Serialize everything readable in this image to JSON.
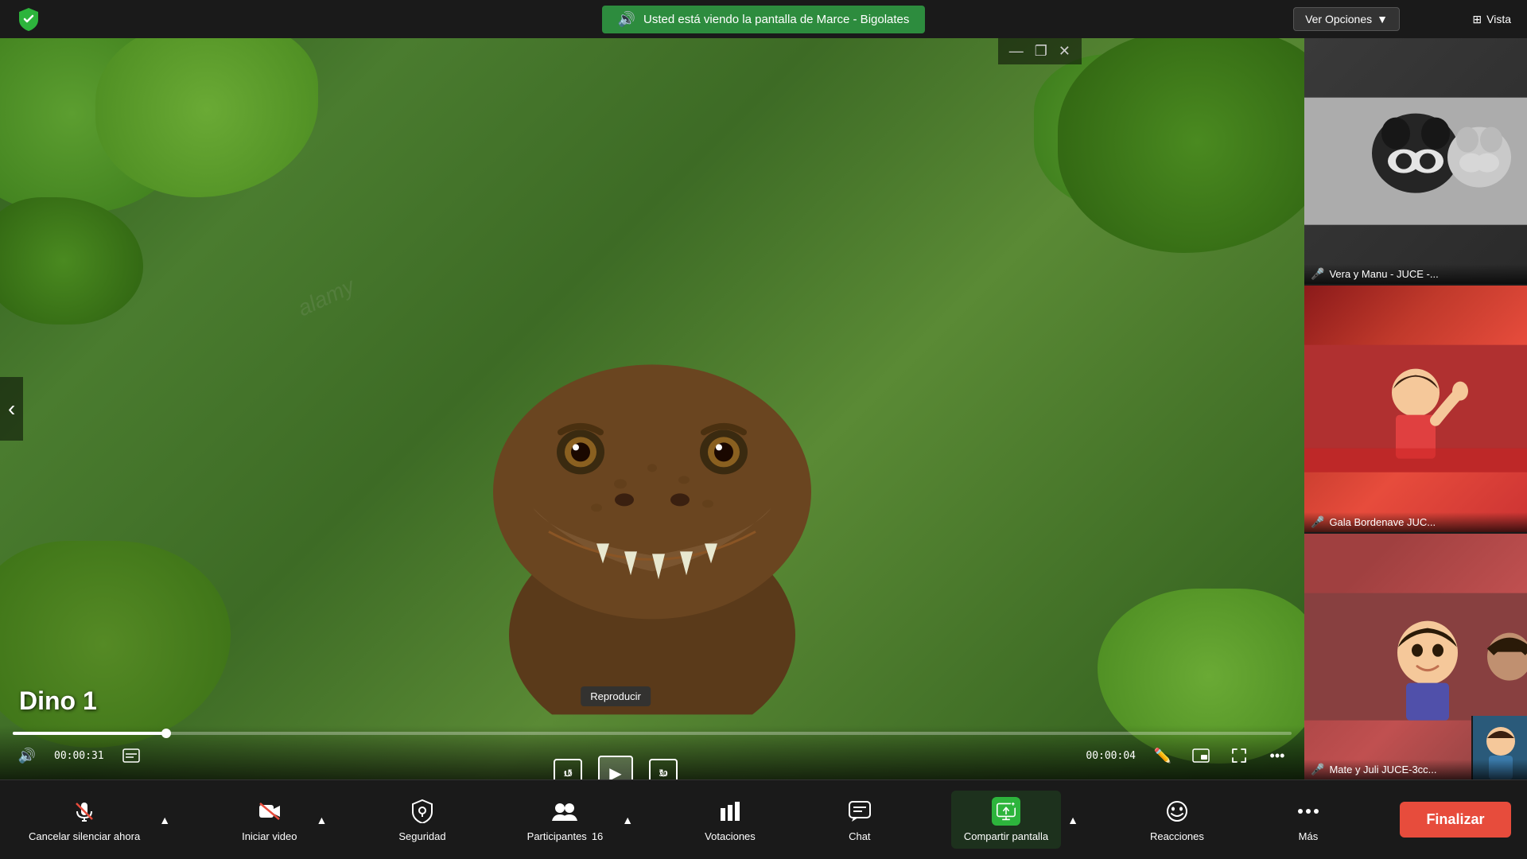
{
  "topBar": {
    "shieldColor": "#2db43c",
    "bannerText": "Usted está viendo la pantalla de Marce - Bigolates",
    "verOpciones": "Ver Opciones",
    "vista": "Vista"
  },
  "mainVideo": {
    "title": "Dino 1",
    "timeElapsed": "00:00:31",
    "timeRemaining": "00:00:04",
    "tooltip": "Reproducir",
    "watermark": "alamy",
    "watermark2": "alamy"
  },
  "participants": [
    {
      "name": "Vera y Manu - JUCE -...",
      "micOff": true
    },
    {
      "name": "Gala Bordenave JUC...",
      "micOff": true
    },
    {
      "name": "Mate y Juli JUCE-3cc...",
      "micOff": true
    }
  ],
  "toolbar": {
    "cancelarSilenciar": "Cancelar silenciar ahora",
    "iniciarVideo": "Iniciar video",
    "seguridad": "Seguridad",
    "participantes": "Participantes",
    "participantesCount": "16",
    "votaciones": "Votaciones",
    "chat": "Chat",
    "compartirPantalla": "Compartir pantalla",
    "reacciones": "Reacciones",
    "mas": "Más",
    "finalizar": "Finalizar"
  },
  "windowControls": {
    "minimize": "—",
    "restore": "❐",
    "close": "✕"
  }
}
